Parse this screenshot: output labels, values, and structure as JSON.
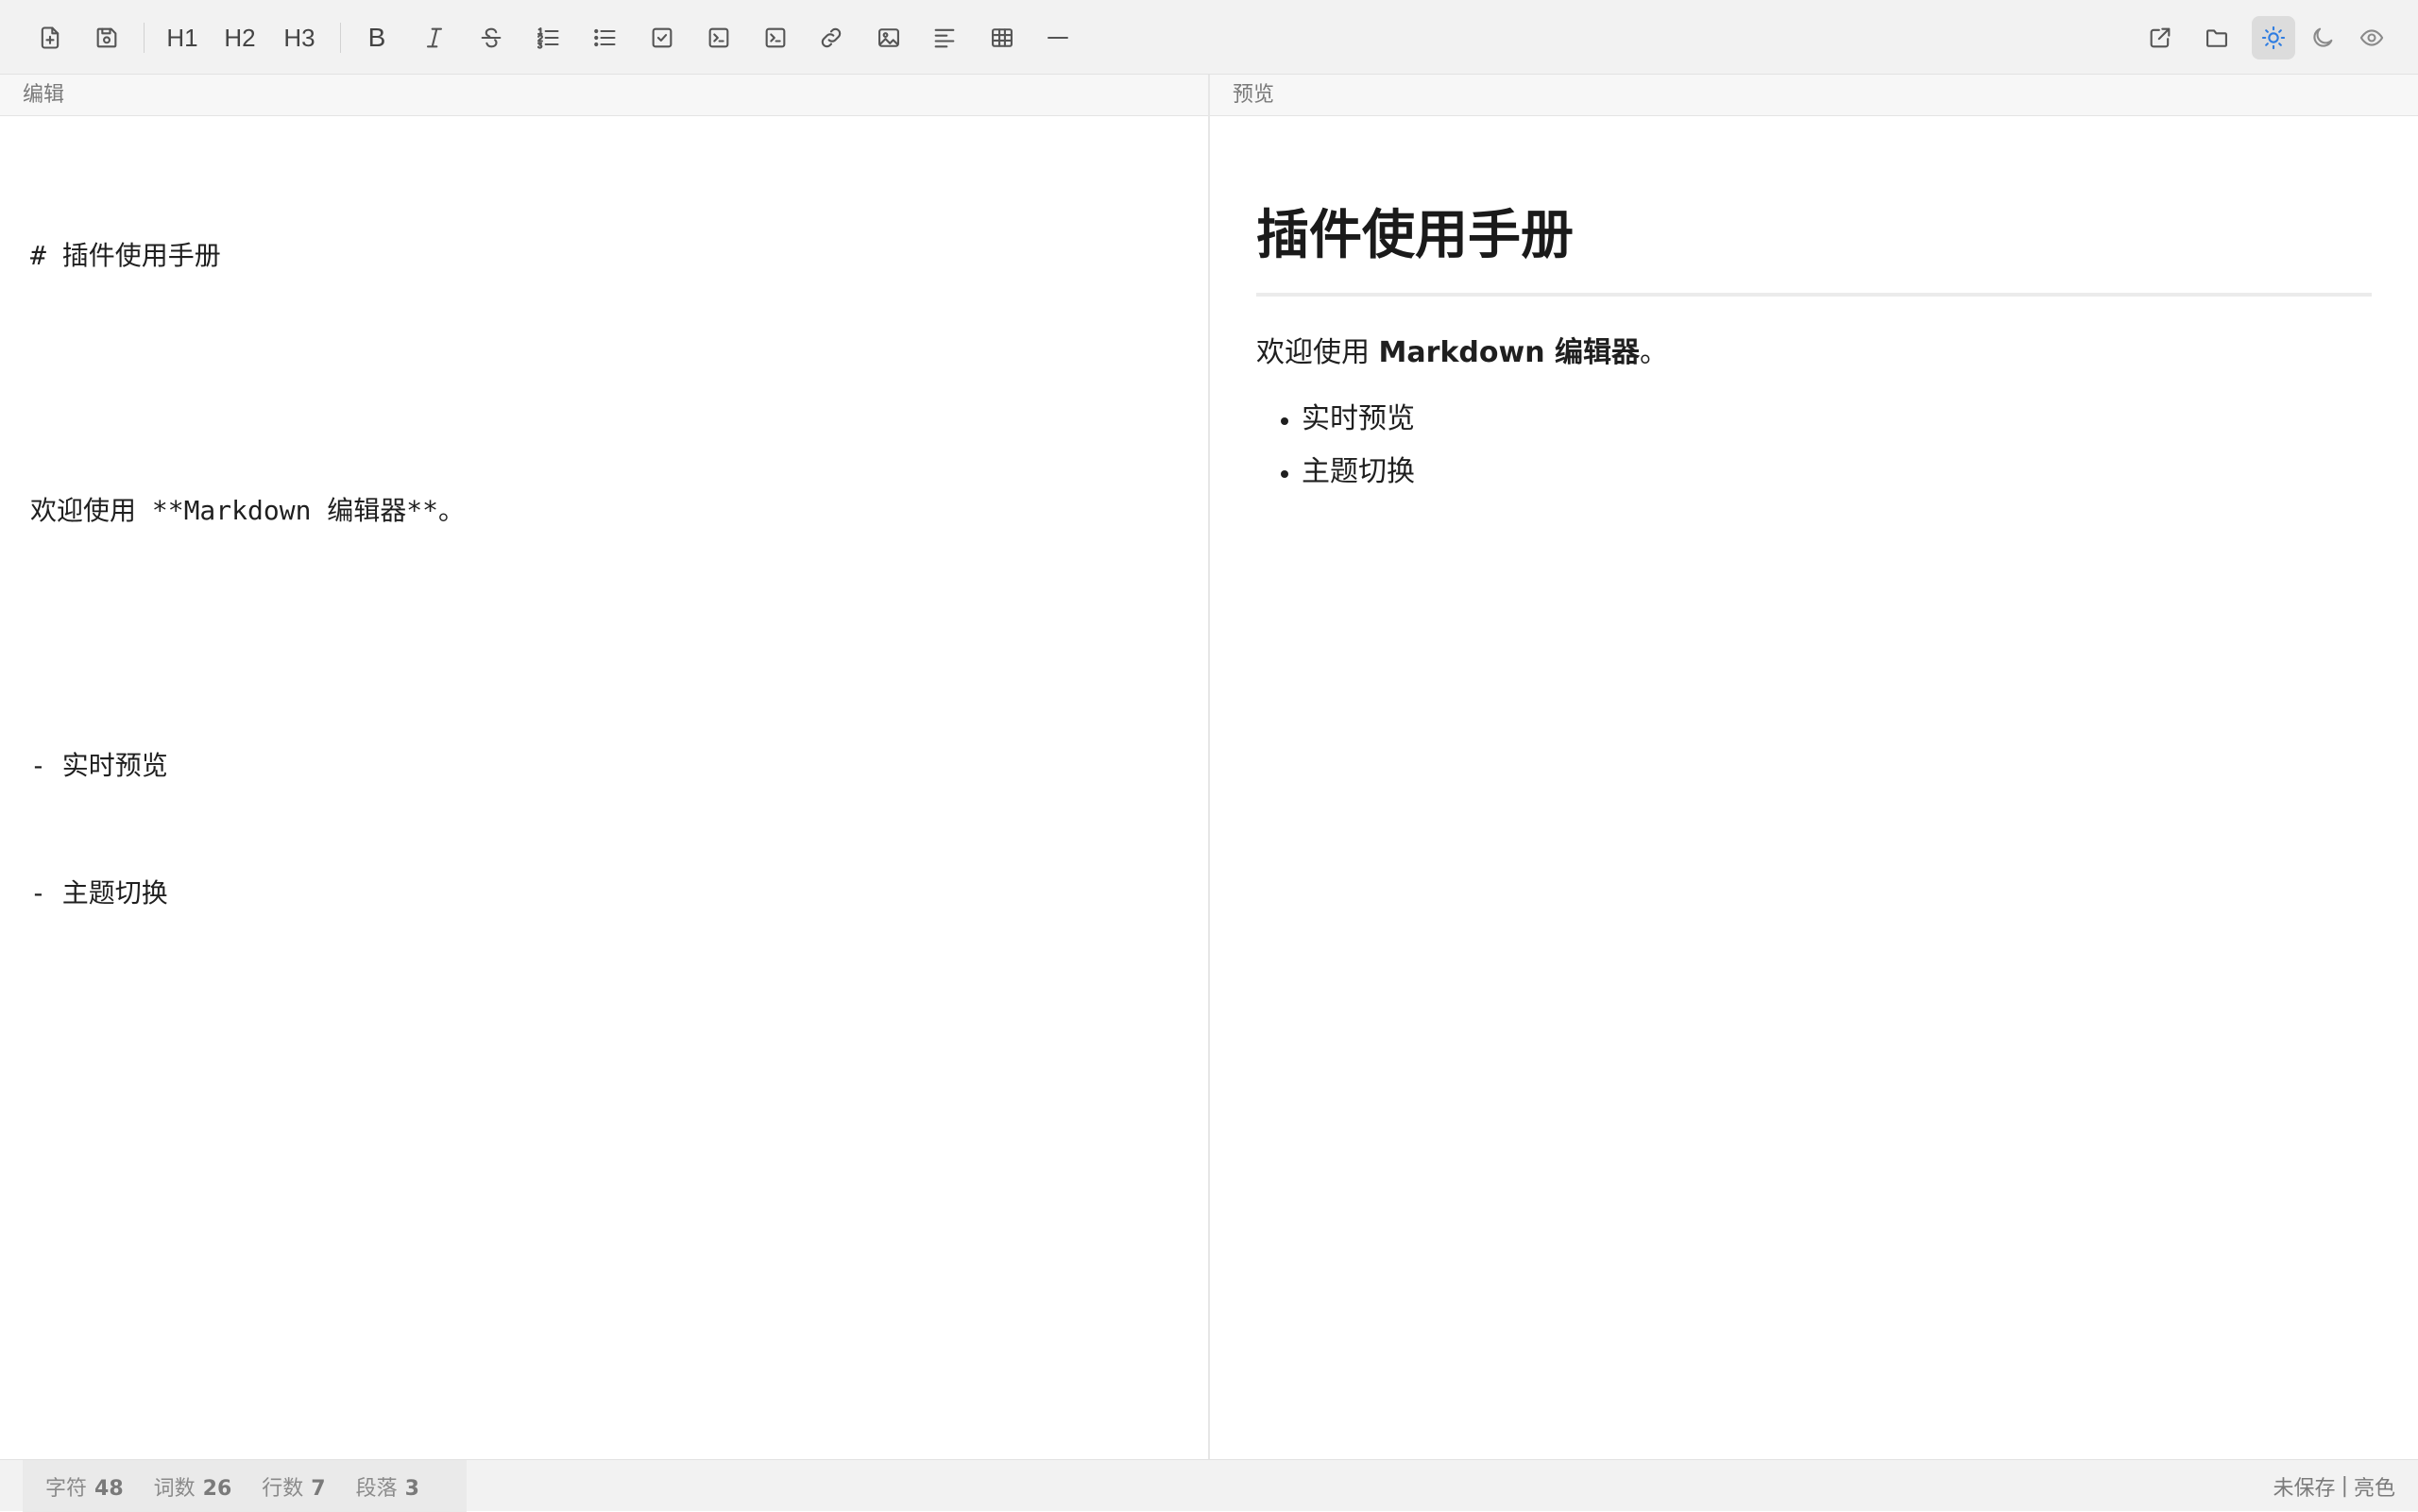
{
  "toolbar": {
    "heading_buttons": [
      "H1",
      "H2",
      "H3"
    ],
    "bold_label": "B",
    "icons": {
      "new_file": "file-plus-icon",
      "save": "save-icon",
      "italic": "italic-icon",
      "strikethrough": "strikethrough-icon",
      "ordered_list": "ordered-list-icon",
      "unordered_list": "unordered-list-icon",
      "task_list": "checkbox-icon",
      "code": "code-terminal-icon",
      "code_block": "code-block-icon",
      "link": "link-icon",
      "image": "image-icon",
      "align": "align-left-icon",
      "table": "table-icon",
      "horizontal_rule": "horizontal-rule-icon",
      "export": "external-link-icon",
      "open_folder": "folder-icon",
      "light_theme": "sun-icon",
      "dark_theme": "moon-icon",
      "preview_toggle": "eye-icon"
    },
    "active_color": "#2f7de1"
  },
  "editor": {
    "header": "编辑",
    "lines": [
      "# 插件使用手册",
      "",
      "欢迎使用 **Markdown 编辑器**。",
      "",
      "- 实时预览",
      "- 主题切换"
    ]
  },
  "preview": {
    "header": "预览",
    "title": "插件使用手册",
    "paragraph_prefix": "欢迎使用 ",
    "paragraph_bold": "Markdown 编辑器",
    "paragraph_suffix": "。",
    "list_items": [
      "实时预览",
      "主题切换"
    ]
  },
  "status": {
    "chars_label": "字符",
    "chars_value": "48",
    "words_label": "词数",
    "words_value": "26",
    "lines_label": "行数",
    "lines_value": "7",
    "paragraphs_label": "段落",
    "paragraphs_value": "3",
    "save_state": "未保存",
    "separator": "|",
    "theme": "亮色"
  }
}
